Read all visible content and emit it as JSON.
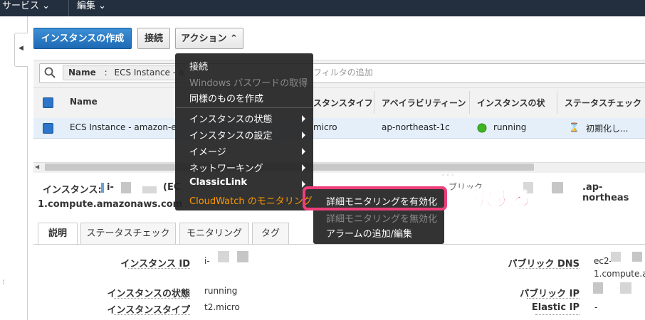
{
  "topbar": {
    "services": "サービス ⌄",
    "edit": "編集 ⌄"
  },
  "toolbar": {
    "create": "インスタンスの作成",
    "connect": "接続",
    "actions": "アクション ⌃"
  },
  "filter": {
    "tag_key": "Name",
    "tag_sep": ":",
    "tag_value": "ECS Instance - a",
    "placeholder": "フィルタの追加"
  },
  "table": {
    "headers": [
      "Name",
      "スタンスタイフ",
      "アベイラビリティーン",
      "インスタンスの状",
      "ステータスチェック"
    ],
    "row": {
      "name": "ECS Instance - amazon-e",
      "type": "micro",
      "az": "ap-northeast-1c",
      "state": "running",
      "status": "初期化し..."
    }
  },
  "instance_line": {
    "label": "インスタンス:",
    "id": "i-",
    "paren": "(EC",
    "public_prefix": "ブリック",
    "dns_tail": ".ap-northeas",
    "dns_line2": "1.compute.amazonaws.com"
  },
  "tabs": [
    "説明",
    "ステータスチェック",
    "モニタリング",
    "タグ"
  ],
  "details": {
    "instance_id_label": "インスタンス ID",
    "instance_id_value": "i-",
    "state_label": "インスタンスの状態",
    "state_value": "running",
    "type_label": "インスタンスタイプ",
    "type_value": "t2.micro",
    "public_dns_label": "パブリック DNS",
    "public_dns_value": "ec2-",
    "public_dns_value2": "1.compute.a",
    "public_ip_label": "パブリック IP",
    "elastic_ip_label": "Elastic IP",
    "elastic_ip_value": "-"
  },
  "menu": {
    "items": [
      "接続",
      "Windows パスワードの取得",
      "同様のものを作成",
      "インスタンスの状態",
      "インスタンスの設定",
      "イメージ",
      "ネットワーキング",
      "ClassicLink",
      "CloudWatch のモニタリング"
    ]
  },
  "submenu": {
    "items": [
      "詳細モニタリングを有効化",
      "詳細モニタリングを無効化",
      "アラームの追加/編集"
    ]
  },
  "callout": "選択する",
  "colors": {
    "topbar": "#232f3e",
    "primary": "#1e6ab4",
    "highlight": "#ee3f7a",
    "menu_active": "#ff9900",
    "running": "#3cb521"
  }
}
